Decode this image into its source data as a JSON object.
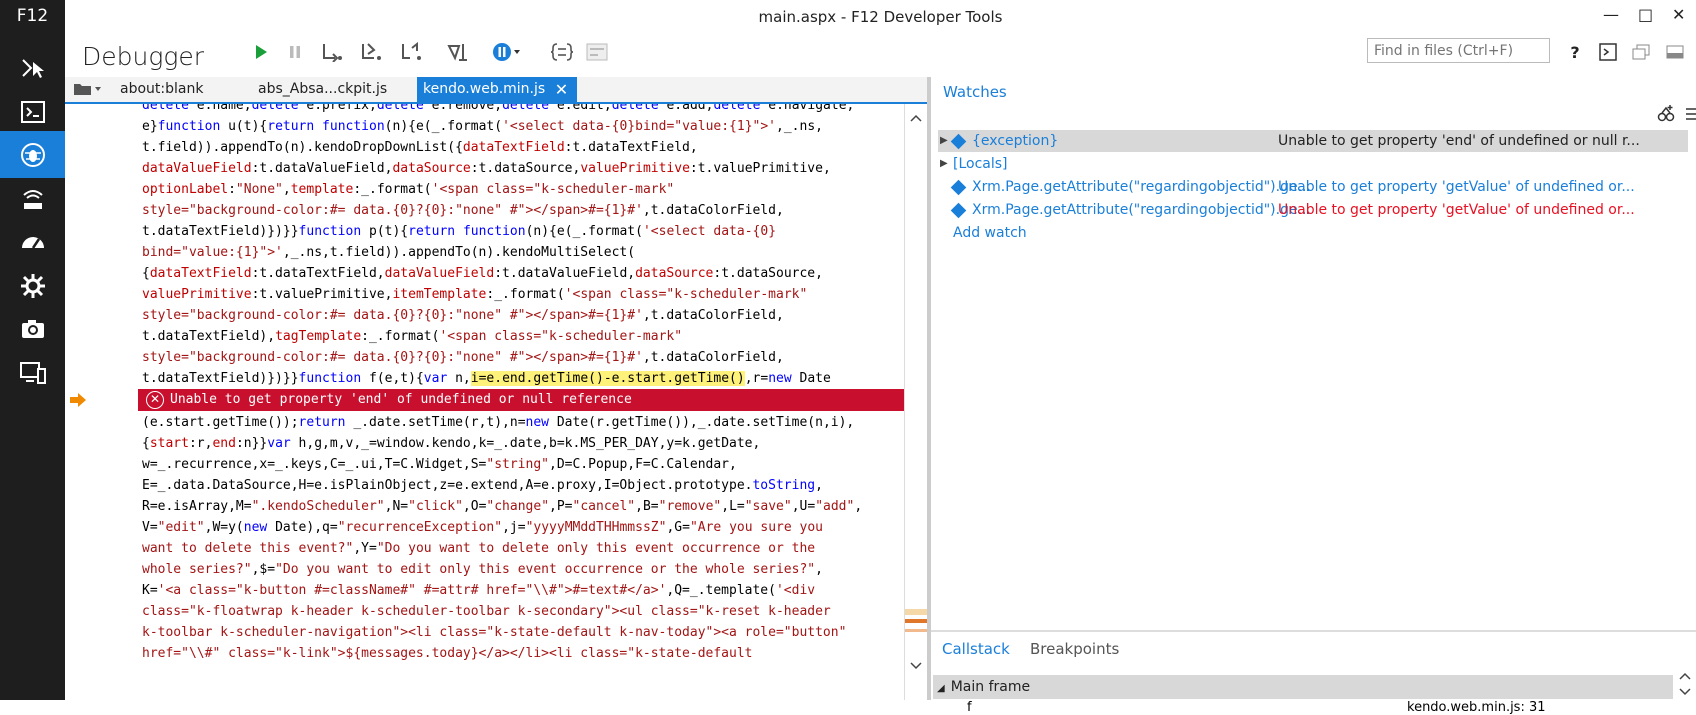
{
  "sidebar": {
    "label": "F12",
    "items": [
      {
        "name": "dom-explorer-icon"
      },
      {
        "name": "console-icon"
      },
      {
        "name": "debugger-icon"
      },
      {
        "name": "network-icon"
      },
      {
        "name": "performance-icon"
      },
      {
        "name": "memory-icon"
      },
      {
        "name": "emulation-icon"
      },
      {
        "name": "experiments-icon"
      }
    ]
  },
  "window": {
    "title": "main.aspx - F12 Developer Tools"
  },
  "toolbar": {
    "title": "Debugger",
    "search_placeholder": "Find in files (Ctrl+F)"
  },
  "tabs": [
    {
      "label": "about:blank"
    },
    {
      "label": "abs_Absa...ckpit.js"
    },
    {
      "label": "kendo.web.min.js",
      "active": true
    }
  ],
  "code": {
    "error_message": "Unable to get property 'end' of undefined or null reference"
  },
  "watches": {
    "title": "Watches",
    "rows": [
      {
        "name": "{exception}",
        "value": "Unable to get property 'end' of undefined or null r...",
        "value_color": "#222222",
        "expandable": true,
        "selected": true
      },
      {
        "name": "[Locals]",
        "value": "",
        "value_color": "#222222",
        "expandable": true,
        "selected": false
      },
      {
        "name": "Xrm.Page.getAttribute(\"regardingobjectid\").ge...",
        "value": "Unable to get property 'getValue' of undefined or...",
        "value_color": "#1a7fd9",
        "expandable": false,
        "selected": false
      },
      {
        "name": "Xrm.Page.getAttribute(\"regardingobjectid\").ge...",
        "value": "Unable to get property 'getValue' of undefined or...",
        "value_color": "#e81123",
        "expandable": false,
        "selected": false
      }
    ],
    "add_watch": "Add watch"
  },
  "callstack": {
    "tabs": [
      "Callstack",
      "Breakpoints"
    ],
    "frame_header": "Main frame",
    "first_frame": "f",
    "first_frame_location": "kendo.web.min.js: 31"
  },
  "colors": {
    "accent": "#1a7fd9",
    "error": "#c8102e",
    "sidebar": "#1e1e1e"
  }
}
